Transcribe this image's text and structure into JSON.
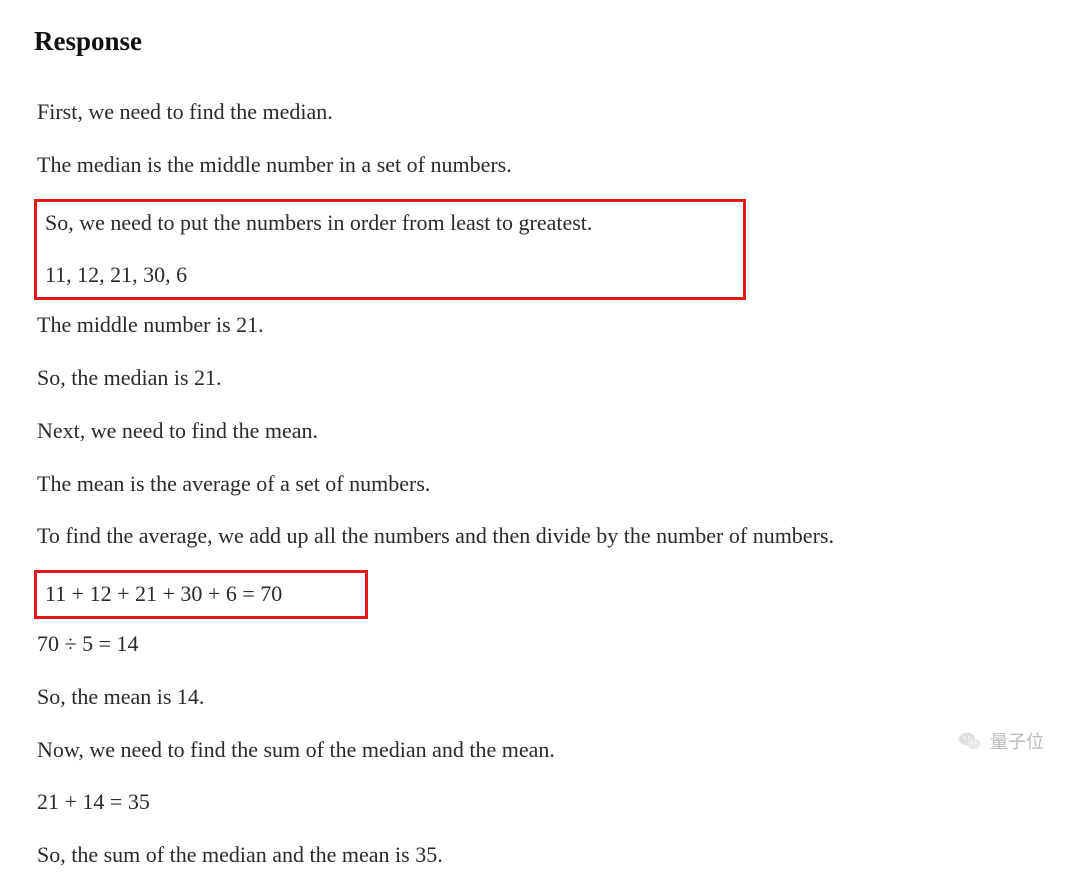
{
  "heading": "Response",
  "lines": {
    "l1": "First, we need to find the median.",
    "l2": "The median is the middle number in a set of numbers.",
    "l3": "So, we need to put the numbers in order from least to greatest.",
    "l4": "11, 12, 21, 30, 6",
    "l5": "The middle number is 21.",
    "l6": "So, the median is 21.",
    "l7": "Next, we need to find the mean.",
    "l8": "The mean is the average of a set of numbers.",
    "l9": "To find the average, we add up all the numbers and then divide by the number of numbers.",
    "l10": "11 + 12 + 21 + 30 + 6 = 70",
    "l11": "70 ÷ 5 = 14",
    "l12": "So, the mean is 14.",
    "l13": "Now, we need to find the sum of the median and the mean.",
    "l14": "21 + 14 = 35",
    "l15": "So, the sum of the median and the mean is 35."
  },
  "highlights": {
    "box1_lines": [
      "l3",
      "l4"
    ],
    "box2_lines": [
      "l10"
    ]
  },
  "watermark": {
    "text": "量子位"
  }
}
